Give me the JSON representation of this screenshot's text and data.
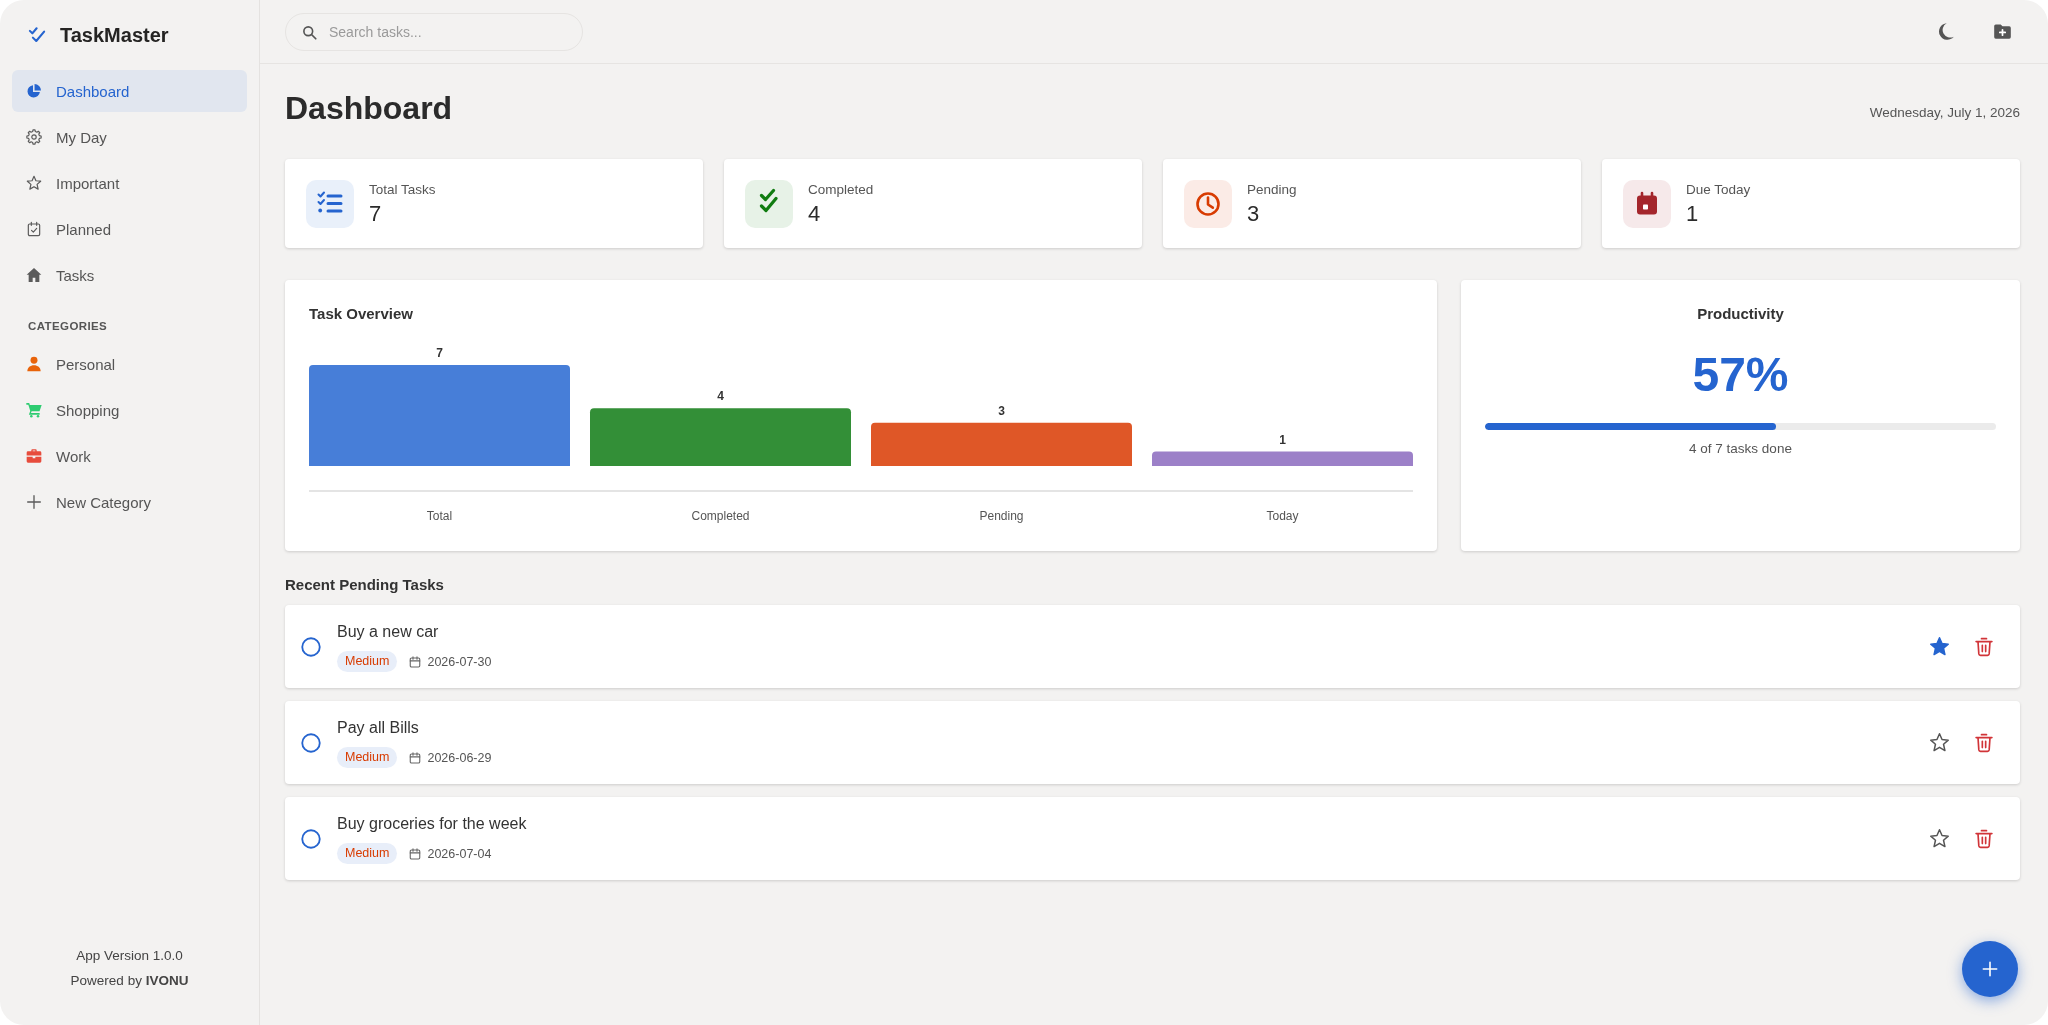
{
  "sidebar": {
    "app_name": "TaskMaster",
    "nav": [
      {
        "label": "Dashboard",
        "selected": true
      },
      {
        "label": "My Day",
        "selected": false
      },
      {
        "label": "Important",
        "selected": false
      },
      {
        "label": "Planned",
        "selected": false
      },
      {
        "label": "Tasks",
        "selected": false
      }
    ],
    "categories_heading": "CATEGORIES",
    "categories": [
      {
        "label": "Personal",
        "color": "#e8630a",
        "selected": false
      },
      {
        "label": "Shopping",
        "color": "#2ecc71",
        "selected": false
      },
      {
        "label": "Work",
        "color": "#e74c3c",
        "selected": false
      }
    ],
    "new_category": "New Category",
    "version": "App Version 1.0.0",
    "credit": "Powered by **IVONU**"
  },
  "topbar": {
    "search": {
      "placeholder": "Search tasks..."
    }
  },
  "page": {
    "title": "Dashboard",
    "date": "Wednesday, July 1, 2026"
  },
  "stats": [
    {
      "label": "Total Tasks",
      "value": "7",
      "color": "#2564cf"
    },
    {
      "label": "Completed",
      "value": "4",
      "color": "#107c10"
    },
    {
      "label": "Pending",
      "value": "3",
      "color": "#d83b01"
    },
    {
      "label": "Due Today",
      "value": "1",
      "color": "#a4262c"
    }
  ],
  "overview": {
    "chart_data": {
      "type": "bar",
      "title": "Task Overview",
      "categories": [
        "Total",
        "Completed",
        "Pending",
        "Today"
      ],
      "values": [
        7,
        4,
        3,
        1
      ],
      "colors": [
        "#477ed8",
        "#338f37",
        "#df5727",
        "#9c80c8"
      ],
      "data_labels": true
    }
  },
  "productivity": {
    "title": "Productivity",
    "percent": "57%",
    "level": 0.57,
    "caption": "4 of 7 tasks done"
  },
  "recent": {
    "title": "Recent Pending Tasks",
    "tasks": [
      {
        "title": "Buy a new car",
        "priority": "Medium",
        "due": "2026-07-30",
        "completed": false,
        "important": true
      },
      {
        "title": "Pay all Bills",
        "priority": "Medium",
        "due": "2026-06-29",
        "completed": false,
        "important": false
      },
      {
        "title": "Buy groceries for the week",
        "priority": "Medium",
        "due": "2026-07-04",
        "completed": false,
        "important": false
      }
    ]
  }
}
